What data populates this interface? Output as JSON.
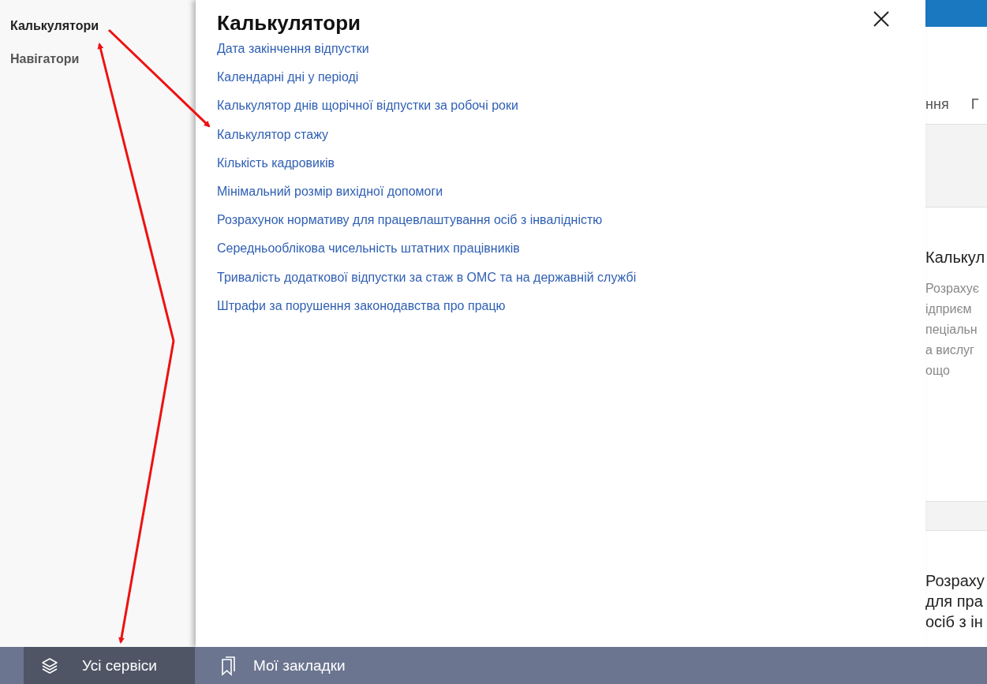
{
  "sidebar": {
    "items": [
      {
        "label": "Калькулятори",
        "selected": true
      },
      {
        "label": "Навігатори",
        "selected": false
      }
    ]
  },
  "panel": {
    "title": "Калькулятори",
    "links": [
      "Дата закінчення відпустки",
      "Календарні дні у періоді",
      "Калькулятор днів щорічної відпустки за робочі роки",
      "Калькулятор стажу",
      "Кількість кадровиків",
      "Мінімальний розмір вихідної допомоги",
      "Розрахунок нормативу для працевлаштування осіб з інвалідністю",
      "Середньооблікова чисельність штатних працівників",
      "Тривалість додаткової відпустки за стаж в ОМС та на державній службі",
      "Штрафи за порушення законодавства про працю"
    ]
  },
  "background_page": {
    "tabs": [
      "ння",
      "Г"
    ],
    "cards": [
      {
        "title_lines": [
          "Калькул"
        ],
        "text_lines": [
          "Розрахує",
          "ідприєм",
          "пеціальн",
          "а вислуг",
          "ощо"
        ]
      },
      {
        "title_lines": [
          "Розраху",
          "для пра",
          "осіб з ін"
        ]
      }
    ]
  },
  "bottom_bar": {
    "tabs": [
      {
        "label": "Усі сервіси",
        "selected": true
      },
      {
        "label": "Мої закладки",
        "selected": false
      }
    ]
  }
}
